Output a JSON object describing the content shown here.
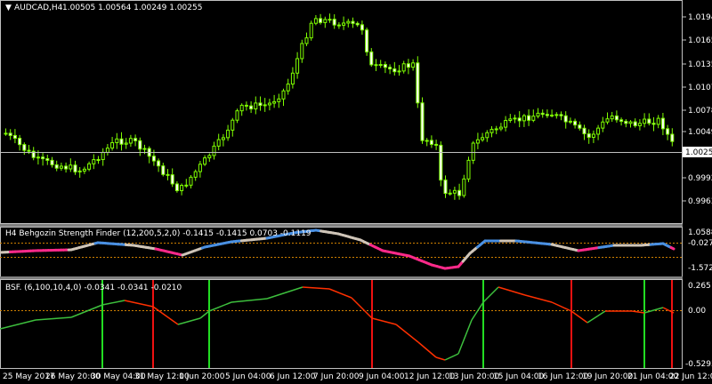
{
  "window": {
    "symbol_title": "AUDCAD,H4",
    "ohlc": "1.00505 1.00564 1.00249 1.00255",
    "bid_label": "1.00255"
  },
  "price_axis": [
    "1.01944",
    "1.01650",
    "1.01356",
    "1.01071",
    "1.00787",
    "1.00497",
    "0.99922",
    "0.99632"
  ],
  "indicator1": {
    "title": "H4 Behgozin Strength Finder (12,200,5,2,0) -0.1415 -0.1415 0.0703 -0.1119",
    "axis": [
      "1.0588",
      "-0.0272",
      "-1.5728"
    ]
  },
  "indicator2": {
    "title": "BSF. (6,100,10,4,0) -0.0341 -0.0341 -0.0210",
    "axis": [
      "0.265",
      "0.00",
      "-0.5293"
    ]
  },
  "time_axis": [
    "25 May 2017",
    "26 May 20:00",
    "30 May 04:00",
    "31 May 12:00",
    "1 Jun 20:00",
    "5 Jun 04:00",
    "6 Jun 12:00",
    "7 Jun 20:00",
    "9 Jun 04:00",
    "12 Jun 12:00",
    "13 Jun 20:00",
    "15 Jun 04:00",
    "16 Jun 12:00",
    "19 Jun 20:00",
    "21 Jun 04:00",
    "22 Jun 12:00"
  ],
  "colors": {
    "candle": "#7fff00",
    "grid": "#c0c0c0",
    "bid_line": "#c0c0c0",
    "strength_gray": "#cfc5b8",
    "strength_blue": "#4a90e2",
    "strength_pink": "#ff2a8a",
    "bsf_green": "#3dbf3d",
    "bsf_red": "#ff3000",
    "dotted_orange": "#d08000",
    "vline_green": "#22dd22",
    "vline_red": "#ee1111"
  }
}
